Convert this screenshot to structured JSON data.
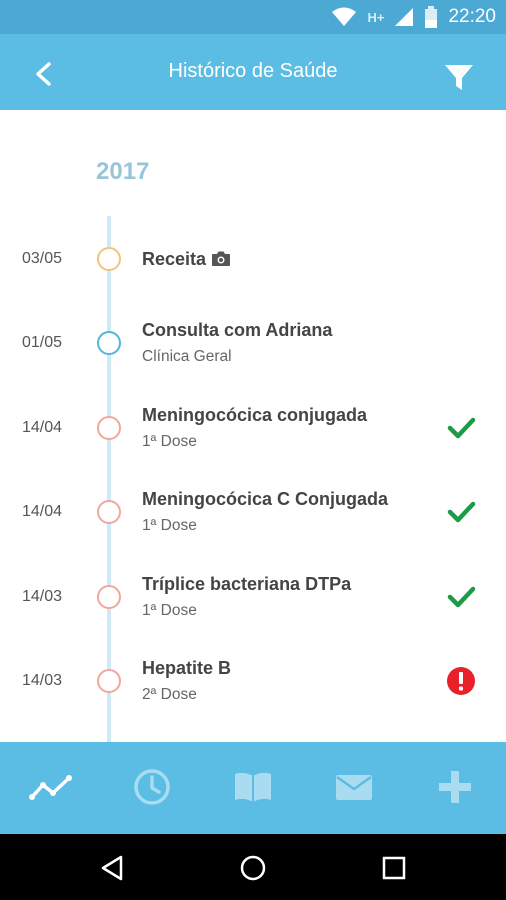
{
  "status_bar": {
    "time": "22:20",
    "network": "H+"
  },
  "app_bar": {
    "title": "Histórico de Saúde",
    "back_icon": "back-arrow-icon",
    "filter_icon": "filter-icon"
  },
  "timeline": {
    "year": "2017",
    "entries": [
      {
        "date": "03/05",
        "name": "Receita",
        "sub": "",
        "dot_color": "#f3c37e",
        "attachment": "camera-icon",
        "status": "none"
      },
      {
        "date": "01/05",
        "name": "Consulta com Adriana",
        "sub": "Clínica Geral",
        "dot_color": "#53b4dd",
        "status": "none"
      },
      {
        "date": "14/04",
        "name": "Meningocócica conjugada",
        "sub": "1ª Dose",
        "dot_color": "#f0a79c",
        "status": "done"
      },
      {
        "date": "14/04",
        "name": "Meningocócica C Conjugada",
        "sub": "1ª Dose",
        "dot_color": "#f0a79c",
        "status": "done"
      },
      {
        "date": "14/03",
        "name": "Tríplice bacteriana DTPa",
        "sub": "1ª Dose",
        "dot_color": "#f0a79c",
        "status": "done"
      },
      {
        "date": "14/03",
        "name": "Hepatite B",
        "sub": "2ª Dose",
        "dot_color": "#f0a79c",
        "status": "alert"
      }
    ]
  },
  "colors": {
    "primary": "#5bbde4",
    "status_bar": "#4ba9d4",
    "check": "#1e9a47",
    "alert": "#e8202a",
    "tab_inactive": "#a9dcf1"
  },
  "tabs": [
    {
      "name": "timeline-tab",
      "icon": "trend-icon",
      "active": true
    },
    {
      "name": "history-tab",
      "icon": "clock-icon",
      "active": false
    },
    {
      "name": "book-tab",
      "icon": "book-icon",
      "active": false
    },
    {
      "name": "messages-tab",
      "icon": "mail-icon",
      "active": false
    },
    {
      "name": "add-tab",
      "icon": "plus-icon",
      "active": false
    }
  ]
}
